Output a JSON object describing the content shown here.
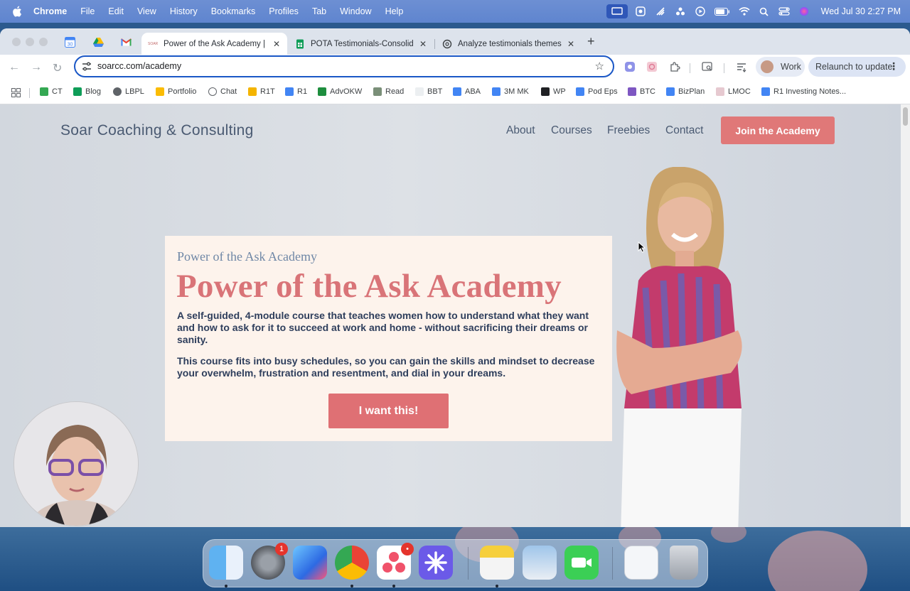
{
  "menubar": {
    "app_name": "Chrome",
    "menus": [
      "File",
      "Edit",
      "View",
      "History",
      "Bookmarks",
      "Profiles",
      "Tab",
      "Window",
      "Help"
    ],
    "clock": "Wed Jul 30  2:27 PM"
  },
  "tabs": [
    {
      "title": "Power of the Ask Academy | S",
      "active": true
    },
    {
      "title": "POTA Testimonials-Consolida",
      "active": false
    },
    {
      "title": "Analyze testimonials themes",
      "active": false
    }
  ],
  "toolbar": {
    "url": "soarcc.com/academy",
    "profile_label": "Work",
    "relaunch_label": "Relaunch to update"
  },
  "bookmarks": [
    "CT",
    "Blog",
    "LBPL",
    "Portfolio",
    "Chat",
    "R1T",
    "R1",
    "AdvOKW",
    "Read",
    "BBT",
    "ABA",
    "3M MK",
    "WP",
    "Pod Eps",
    "BTC",
    "BizPlan",
    "LMOC",
    "R1 Investing Notes..."
  ],
  "site": {
    "brand": "Soar Coaching & Consulting",
    "nav": [
      "About",
      "Courses",
      "Freebies",
      "Contact"
    ],
    "cta": "Join the Academy"
  },
  "hero": {
    "kicker": "Power of the Ask Academy",
    "title": "Power of the Ask Academy",
    "paragraph1": "A self-guided, 4-module course that teaches women how to understand what they want and how to ask for it to succeed at work and home - without sacrificing their dreams or sanity.",
    "paragraph2": "This course fits into busy schedules, so you can gain the skills and mindset to decrease your overwhelm, frustration and resentment, and dial in your dreams.",
    "button": "I want this!"
  },
  "dock": {
    "badges": {
      "system_settings": "1",
      "asana": "•"
    }
  },
  "colors": {
    "brand_pink": "#e07878",
    "hero_title": "#d97478",
    "text_navy": "#2e3e5c",
    "omnibox_focus": "#1a57c6"
  }
}
